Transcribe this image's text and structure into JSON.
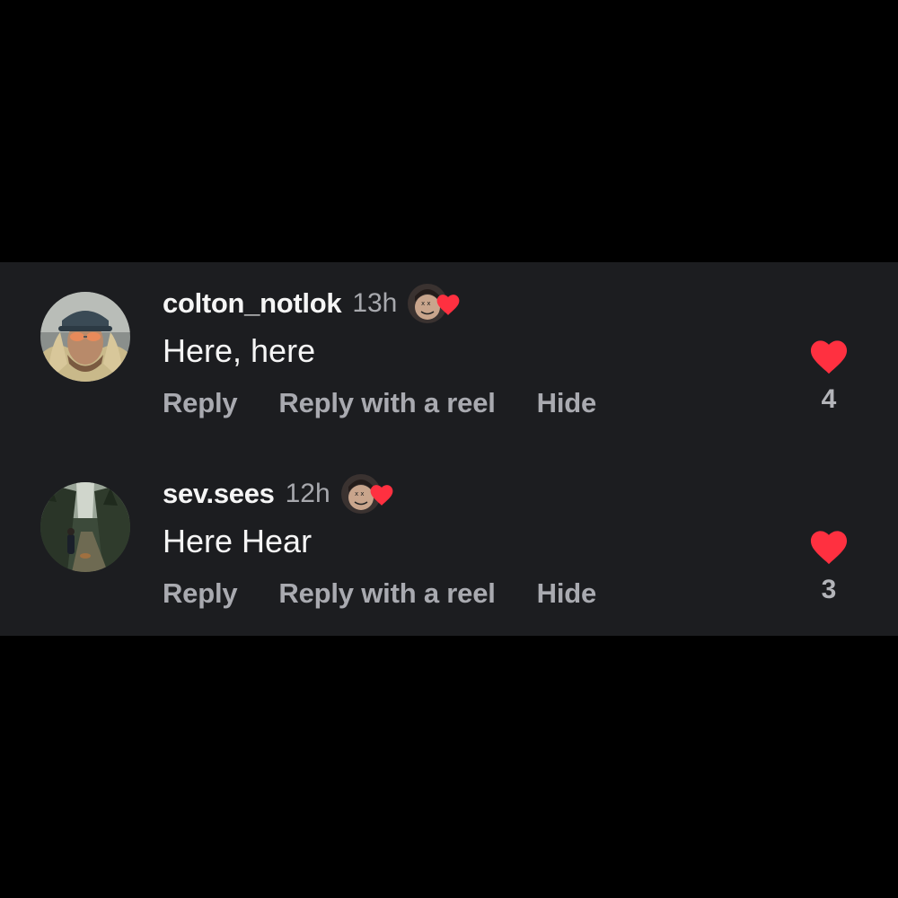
{
  "theme": {
    "background": "#000000",
    "panel": "#1c1d20",
    "text_primary": "#f5f5f5",
    "text_secondary": "#a9aab0",
    "like_red": "#ff3040"
  },
  "comments": [
    {
      "username": "colton_notlok",
      "time": "13h",
      "text": "Here, here",
      "actions": {
        "reply": "Reply",
        "reply_reel": "Reply with a reel",
        "hide": "Hide"
      },
      "like_count": "4",
      "liked_by_creator": true,
      "liked_icon": "heart-filled-icon"
    },
    {
      "username": "sev.sees",
      "time": "12h",
      "text": "Here Hear",
      "actions": {
        "reply": "Reply",
        "reply_reel": "Reply with a reel",
        "hide": "Hide"
      },
      "like_count": "3",
      "liked_by_creator": true,
      "liked_icon": "heart-filled-icon"
    }
  ]
}
